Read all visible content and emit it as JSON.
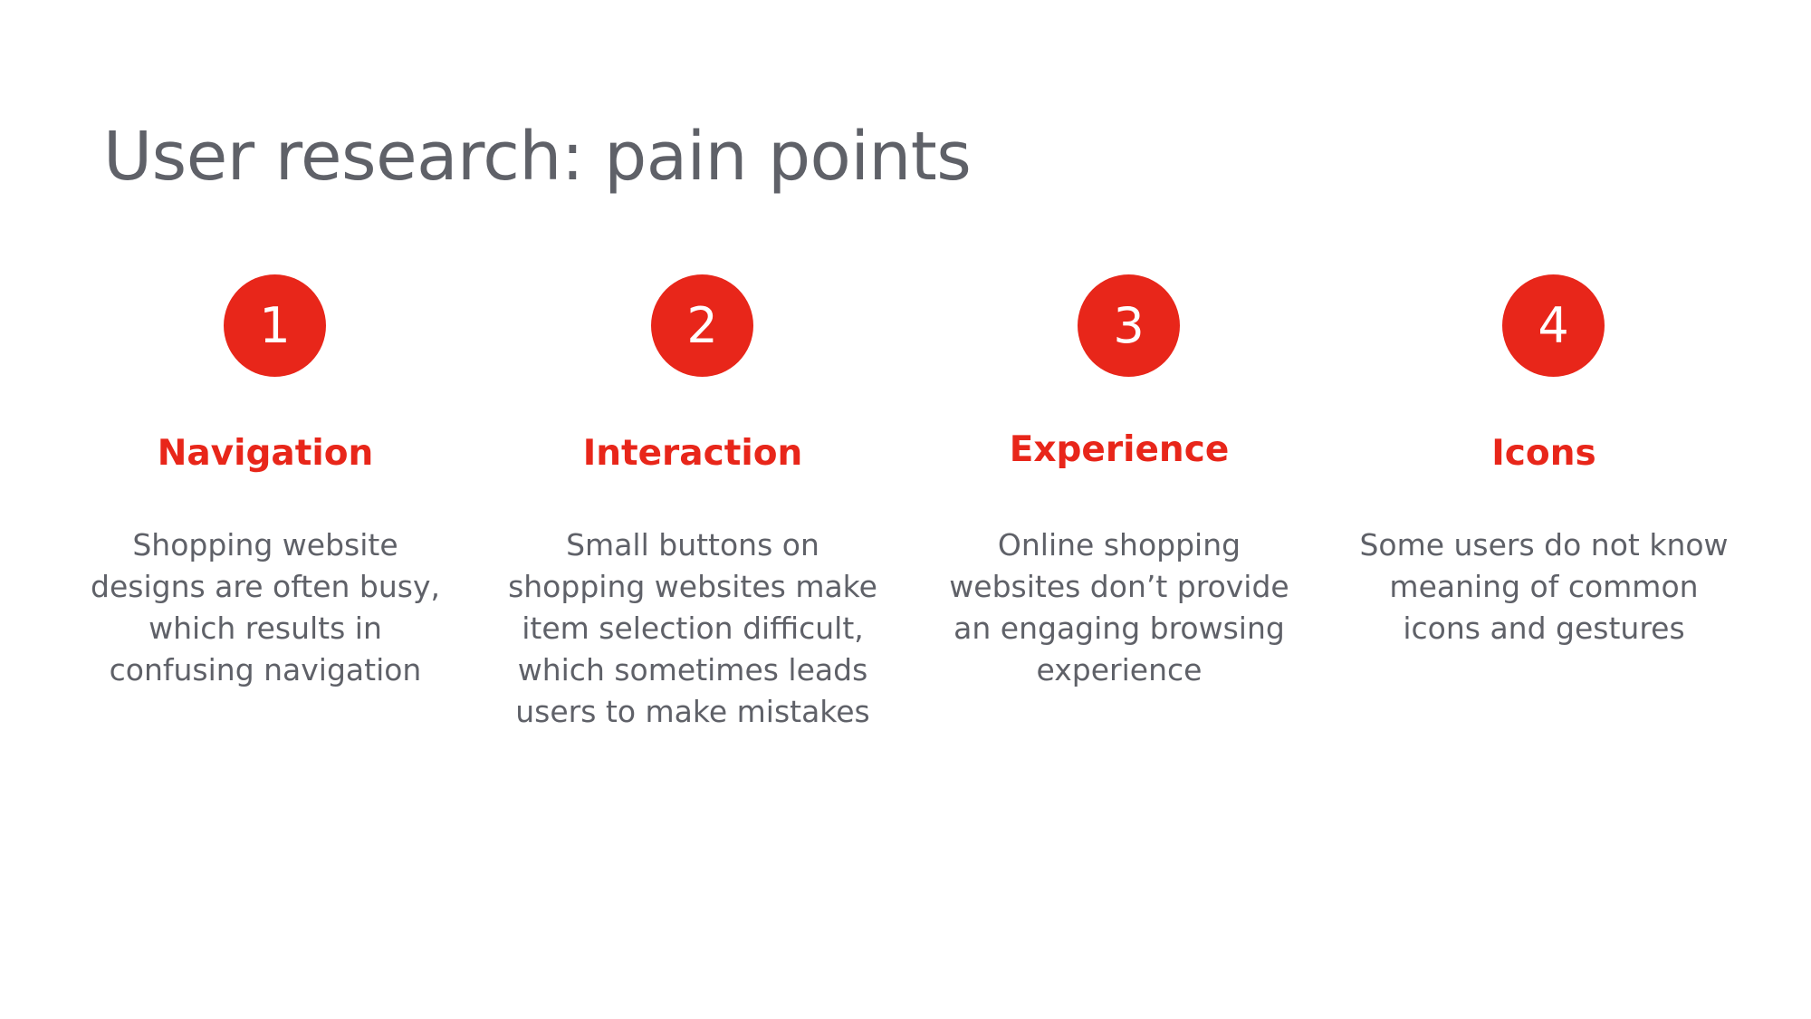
{
  "slide": {
    "title": "User research: pain points",
    "accent_color": "#e8261a",
    "text_color": "#5f6168"
  },
  "pain_points": [
    {
      "number": "1",
      "heading": "Navigation",
      "description_lines": [
        "Shopping website",
        "designs are often busy,",
        "which results in",
        "confusing navigation"
      ]
    },
    {
      "number": "2",
      "heading": "Interaction",
      "description_lines": [
        "Small buttons on",
        "shopping websites make",
        "item selection difficult,",
        "which sometimes leads",
        "users to make mistakes"
      ]
    },
    {
      "number": "3",
      "heading": "Experience",
      "description_lines": [
        "Online shopping",
        "websites don’t provide",
        "an engaging browsing",
        "experience"
      ]
    },
    {
      "number": "4",
      "heading": "Icons",
      "description_lines": [
        "Some users do not know",
        "meaning of common",
        "icons and gestures"
      ]
    }
  ]
}
